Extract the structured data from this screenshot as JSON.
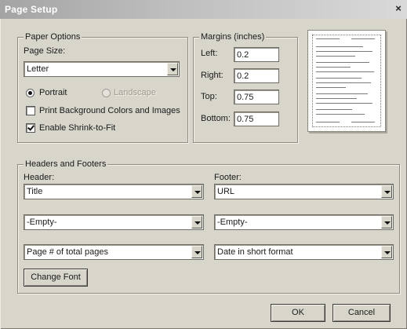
{
  "window": {
    "title": "Page Setup",
    "close_glyph": "×"
  },
  "paper_options": {
    "legend": "Paper Options",
    "page_size_label": "Page Size:",
    "page_size_value": "Letter",
    "portrait_label": "Portrait",
    "portrait_selected": true,
    "landscape_label": "Landscape",
    "landscape_enabled": false,
    "print_background_label": "Print Background Colors and Images",
    "print_background_checked": false,
    "shrink_to_fit_label": "Enable Shrink-to-Fit",
    "shrink_to_fit_checked": true
  },
  "margins": {
    "legend": "Margins (inches)",
    "left_label": "Left:",
    "left_value": "0.2",
    "right_label": "Right:",
    "right_value": "0.2",
    "top_label": "Top:",
    "top_value": "0.75",
    "bottom_label": "Bottom:",
    "bottom_value": "0.75"
  },
  "headers_footers": {
    "legend": "Headers and Footers",
    "header_label": "Header:",
    "footer_label": "Footer:",
    "header_values": [
      "Title",
      "-Empty-",
      "Page # of total pages"
    ],
    "footer_values": [
      "URL",
      "-Empty-",
      "Date in short format"
    ],
    "change_font_label": "Change Font"
  },
  "buttons": {
    "ok_label": "OK",
    "cancel_label": "Cancel"
  },
  "icons": {
    "dropdown": "chevron-down-icon",
    "close": "close-icon"
  }
}
